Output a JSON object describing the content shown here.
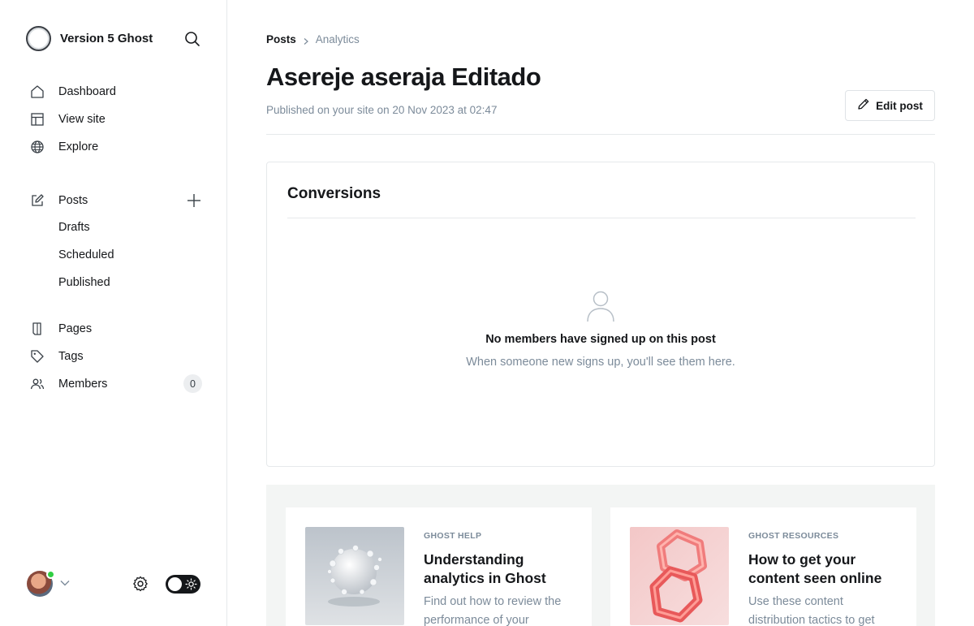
{
  "sidebar": {
    "brand_name": "Version 5 Ghost",
    "nav": [
      {
        "label": "Dashboard",
        "icon": "home-icon"
      },
      {
        "label": "View site",
        "icon": "layout-icon"
      },
      {
        "label": "Explore",
        "icon": "globe-icon"
      }
    ],
    "posts": {
      "label": "Posts",
      "icon": "edit-icon",
      "sub_items": [
        "Drafts",
        "Scheduled",
        "Published"
      ]
    },
    "secondary_nav": [
      {
        "label": "Pages",
        "icon": "page-icon"
      },
      {
        "label": "Tags",
        "icon": "tag-icon"
      },
      {
        "label": "Members",
        "icon": "members-icon",
        "count": "0"
      }
    ],
    "user": {
      "status_color": "#30cf43"
    }
  },
  "breadcrumb": {
    "parent": "Posts",
    "current": "Analytics"
  },
  "post": {
    "title": "Asereje aseraja Editado",
    "meta": "Published on your site on 20 Nov 2023 at 02:47",
    "edit_label": "Edit post"
  },
  "conversions": {
    "title": "Conversions",
    "empty_title": "No members have signed up on this post",
    "empty_desc": "When someone new signs up, you'll see them here."
  },
  "resources": [
    {
      "tag": "GHOST HELP",
      "title": "Understanding analytics in Ghost",
      "desc": "Find out how to review the performance of your"
    },
    {
      "tag": "GHOST RESOURCES",
      "title": "How to get your content seen online",
      "desc": "Use these content distribution tactics to get"
    }
  ],
  "colors": {
    "accent": "#15171a",
    "muted": "#7c8b9a",
    "online": "#30cf43"
  }
}
